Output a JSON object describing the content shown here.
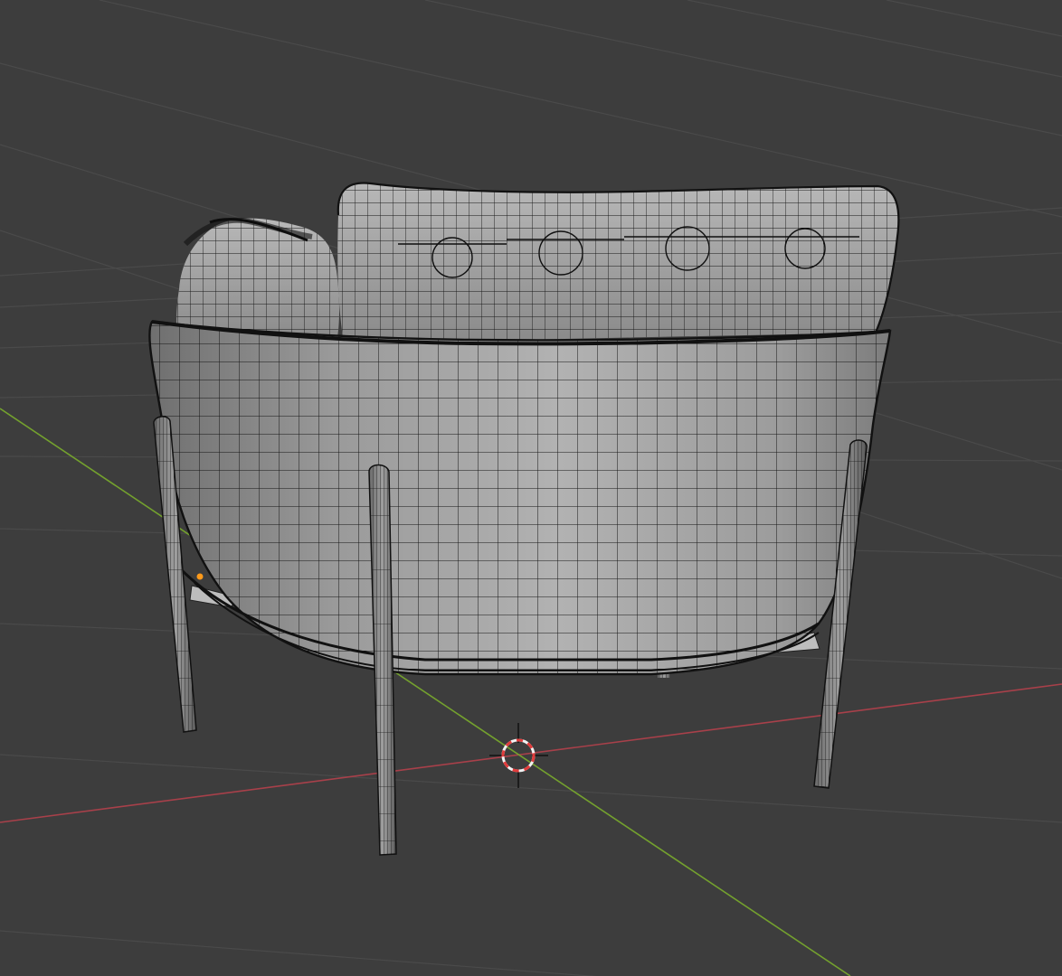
{
  "viewport": {
    "background": "#3d3d3d",
    "grid_color": "#4a4a4a",
    "axis_x_color": "#a8404a",
    "axis_y_color": "#74a12e",
    "mesh_fill": "#8f8f8f",
    "mesh_fill_light": "#aaaaaa",
    "wire_color": "#111111",
    "origin_color": "#ff9a1a",
    "cursor_primary": "#e23b3b",
    "cursor_secondary": "#f2f2f2"
  },
  "scene": {
    "object": "armchair",
    "shading": "solid",
    "overlay": "wireframe",
    "icons": [
      "3d-cursor-icon",
      "object-origin-icon"
    ]
  }
}
